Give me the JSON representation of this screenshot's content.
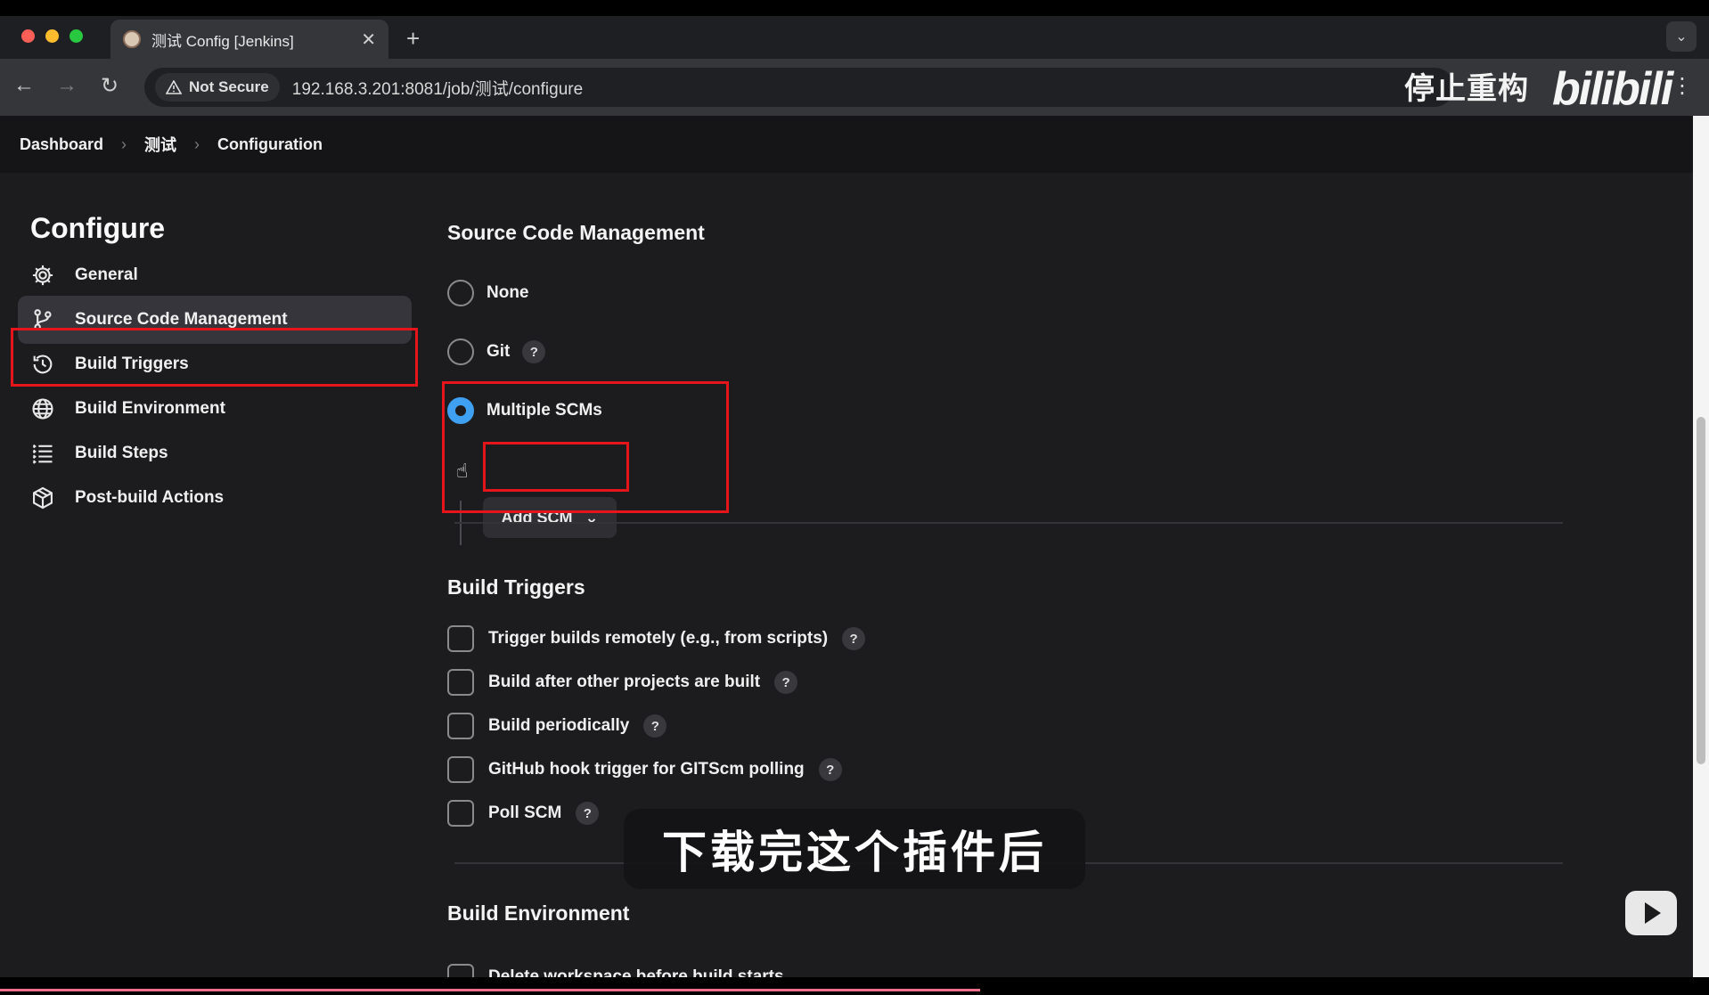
{
  "browser": {
    "tab_title": "测试 Config [Jenkins]",
    "security_label": "Not Secure",
    "url": "192.168.3.201:8081/job/测试/configure"
  },
  "overlay": {
    "watermark_text": "停止重构",
    "brand_text": "bilibili",
    "subtitle": "下载完这个插件后"
  },
  "breadcrumb": [
    "Dashboard",
    "测试",
    "Configuration"
  ],
  "sidebar": {
    "title": "Configure",
    "items": [
      {
        "label": "General",
        "icon": "gear-icon"
      },
      {
        "label": "Source Code Management",
        "icon": "branch-icon",
        "active": true
      },
      {
        "label": "Build Triggers",
        "icon": "clock-icon"
      },
      {
        "label": "Build Environment",
        "icon": "globe-icon"
      },
      {
        "label": "Build Steps",
        "icon": "list-icon"
      },
      {
        "label": "Post-build Actions",
        "icon": "package-icon"
      }
    ]
  },
  "scm": {
    "title": "Source Code Management",
    "options": [
      {
        "label": "None",
        "selected": false
      },
      {
        "label": "Git",
        "selected": false,
        "help": "?"
      },
      {
        "label": "Multiple SCMs",
        "selected": true
      }
    ],
    "add_scm_label": "Add SCM"
  },
  "build_triggers": {
    "title": "Build Triggers",
    "options": [
      {
        "label": "Trigger builds remotely (e.g., from scripts)",
        "checked": false,
        "help": "?"
      },
      {
        "label": "Build after other projects are built",
        "checked": false,
        "help": "?"
      },
      {
        "label": "Build periodically",
        "checked": false,
        "help": "?"
      },
      {
        "label": "GitHub hook trigger for GITScm polling",
        "checked": false,
        "help": "?"
      },
      {
        "label": "Poll SCM",
        "checked": false,
        "help": "?"
      }
    ]
  },
  "build_environment": {
    "title": "Build Environment",
    "first_option": "Delete workspace before build starts"
  },
  "colors": {
    "accent": "#3fa0f2",
    "highlight_box": "#e5151b",
    "background": "#1c1c1e"
  }
}
